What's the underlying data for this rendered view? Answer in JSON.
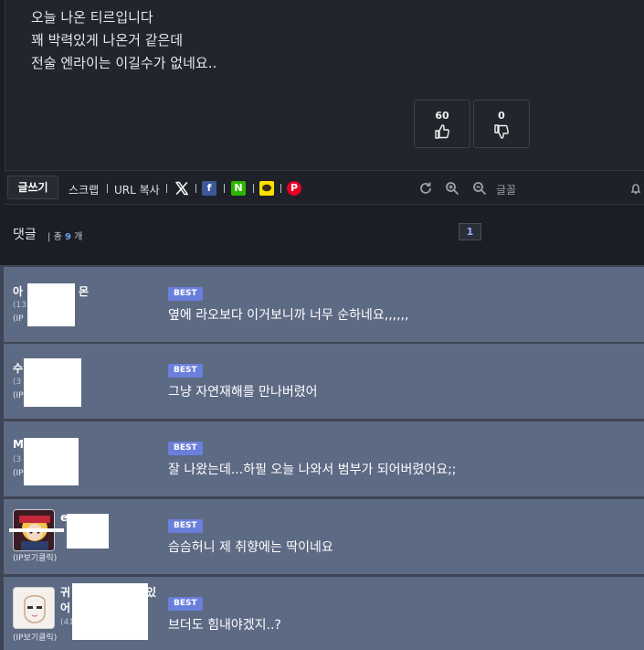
{
  "post": {
    "lines": [
      "오늘 나온 티르입니다",
      "꽤 박력있게 나온거 같은데",
      "전술 엔라이는 이길수가 없네요.."
    ],
    "upvotes": "60",
    "downvotes": "0"
  },
  "toolbar": {
    "write_label": "글쓰기",
    "scrap_label": "스크랩",
    "url_copy_label": "URL 복사",
    "font_label": "글꼴"
  },
  "comment_header": {
    "title": "댓글",
    "total_prefix": "총",
    "total_count": "9",
    "total_suffix": "개",
    "current_page": "1"
  },
  "comments": [
    {
      "nick_left": "아",
      "nick_right": "몬",
      "meta": "(13",
      "ip": "(IP",
      "text": "옆에 라오보다 이거보니까 너무 순하네요,,,,,,"
    },
    {
      "nick_left": "수",
      "nick_right": "",
      "meta": "(3",
      "ip": "(IP",
      "text": "그냥 자연재해를 만나버렸어"
    },
    {
      "nick_left": "M",
      "nick_right": "",
      "meta": "(3",
      "ip": "(IP",
      "text": "잘 나왔는데...하필 오늘 나와서 범부가 되어버렸어요;;"
    },
    {
      "nick_left": "e",
      "nick_right": "",
      "meta": "",
      "ip": "(IP보기클릭)",
      "text": "슴슴허니 제 취향에는 딱이네요"
    },
    {
      "nick_left": "귀",
      "nick_right": "있",
      "nick_line2": "어",
      "meta": "(41",
      "ip": "(IP보기클릭)",
      "text": "브더도 힘내야겠지..?"
    }
  ],
  "best_label": "BEST",
  "colors": {
    "background": "#1b1e24",
    "post_background": "#22252c",
    "comment_background": "#5d6a84",
    "best_badge": "#6a7fdc",
    "accent_blue": "#6f9cf2"
  }
}
